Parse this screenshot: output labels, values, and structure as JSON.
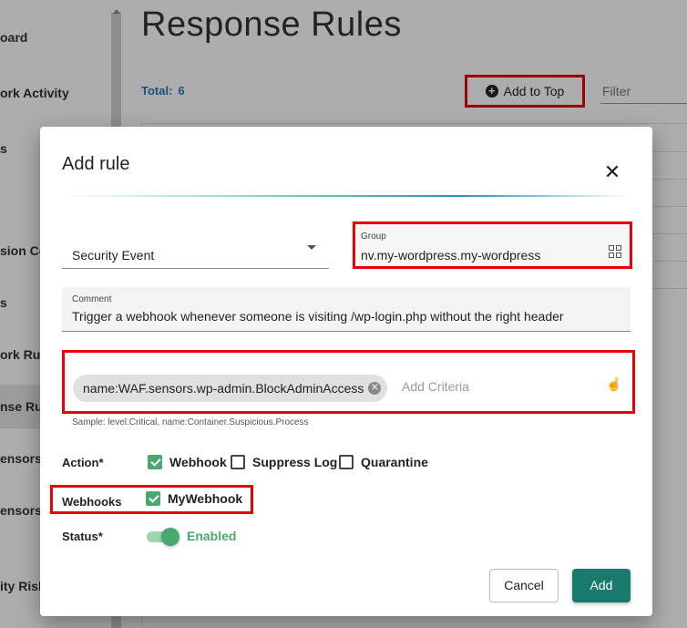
{
  "sidebar": {
    "items": [
      {
        "label": "oard"
      },
      {
        "label": "ork Activity"
      },
      {
        "label": "s"
      },
      {
        "label": ""
      },
      {
        "label": "sion Co"
      },
      {
        "label": "s"
      },
      {
        "label": "ork Rule"
      },
      {
        "label": "nse Rul",
        "active": true
      },
      {
        "label": "ensors"
      },
      {
        "label": "ensors"
      },
      {
        "label": "ity Risk"
      }
    ]
  },
  "page": {
    "title": "Response Rules",
    "total_label": "Total:",
    "total_count": "6",
    "add_to_top_label": "Add to Top",
    "filter_placeholder": "Filter"
  },
  "dialog": {
    "title": "Add rule",
    "type_value": "Security Event",
    "group_label": "Group",
    "group_value": "nv.my-wordpress.my-wordpress",
    "comment_label": "Comment",
    "comment_value": "Trigger a webhook whenever someone is visiting /wp-login.php without the right header",
    "criteria_chip": "name:WAF.sensors.wp-admin.BlockAdminAccess",
    "criteria_placeholder": "Add Criteria",
    "sample_text": "Sample: level:Critical, name:Container.Suspicious.Process",
    "action_label": "Action*",
    "actions": [
      {
        "label": "Webhook",
        "checked": true
      },
      {
        "label": "Suppress Log",
        "checked": false
      },
      {
        "label": "Quarantine",
        "checked": false
      }
    ],
    "webhooks_label": "Webhooks",
    "webhook_option": {
      "label": "MyWebhook",
      "checked": true
    },
    "status_label": "Status*",
    "status_value": "Enabled",
    "status_enabled": true,
    "cancel_label": "Cancel",
    "add_label": "Add"
  },
  "colors": {
    "highlight": "#e8000b",
    "accent_green": "#47a96d",
    "primary_button": "#1a7a6c",
    "total_blue": "#2a7ab8"
  }
}
